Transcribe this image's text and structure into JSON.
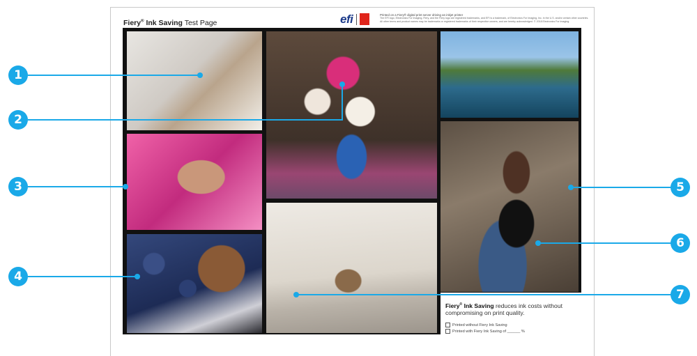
{
  "header": {
    "brand": "Fiery",
    "reg": "®",
    "brand_suffix": " Ink Saving",
    "title_rest": " Test Page",
    "logo_efi": "efi",
    "logo_fiery": "FIERY",
    "fine_line1": "Printed on a Fiery® digital print server driving an inkjet printer",
    "fine_line2": "The EFI logo, Electronics For Imaging, Fiery, and the Fiery logo are registered trademarks, and EFI is a trademark, of Electronics For Imaging, Inc. in the U.S. and/or certain other countries.",
    "fine_line3": "All other terms and product names may be trademarks or registered trademarks of their respective owners, and are hereby acknowledged. © 2018 Electronics For Imaging."
  },
  "note": {
    "brand": "Fiery",
    "reg": "®",
    "brand_suffix": " Ink Saving",
    "text": " reduces ink costs without compromising on print quality.",
    "option1": "Printed without Fiery Ink Saving",
    "option2": "Printed with Fiery Ink Saving of ______ %"
  },
  "markers": [
    "1",
    "2",
    "3",
    "4",
    "5",
    "6",
    "7"
  ],
  "colors": {
    "marker": "#1aa9e8",
    "grid": "#111111",
    "logo_blue": "#1c3b8a",
    "logo_red": "#e0251b"
  }
}
